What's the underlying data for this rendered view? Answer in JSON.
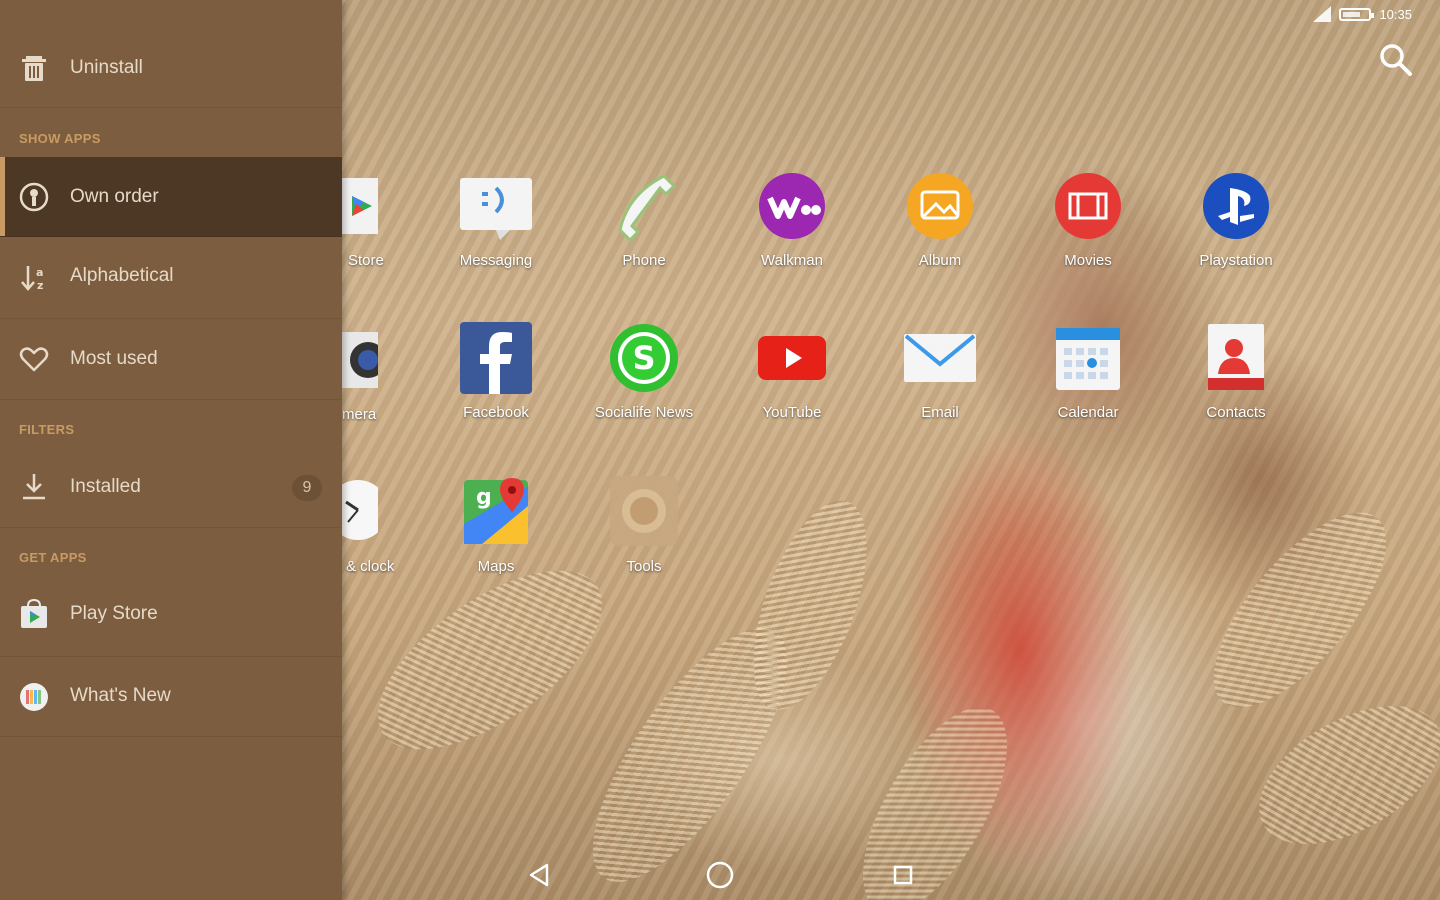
{
  "status_bar": {
    "time": "10:35",
    "battery_text": ""
  },
  "drawer": {
    "uninstall": "Uninstall",
    "show_apps_title": "SHOW APPS",
    "sort_items": [
      {
        "label": "Own order",
        "icon": "person-circle-icon",
        "active": true
      },
      {
        "label": "Alphabetical",
        "icon": "sort-alpha-icon",
        "active": false
      },
      {
        "label": "Most used",
        "icon": "heart-icon",
        "active": false
      }
    ],
    "filters_title": "FILTERS",
    "installed": {
      "label": "Installed",
      "count": "9"
    },
    "get_apps_title": "GET APPS",
    "play_store": "Play Store",
    "whats_new": "What's New"
  },
  "apps": {
    "row1": [
      "Store",
      "Messaging",
      "Phone",
      "Walkman",
      "Album",
      "Movies",
      "Playstation"
    ],
    "row2": [
      "mera",
      "Facebook",
      "Socialife News",
      "YouTube",
      "Email",
      "Calendar",
      "Contacts"
    ],
    "row3": [
      "& clock",
      "Maps",
      "Tools"
    ]
  },
  "colors": {
    "drawer_bg": "#7d5d3f",
    "drawer_active": "#4d3725",
    "section_title": "#c99b64"
  }
}
